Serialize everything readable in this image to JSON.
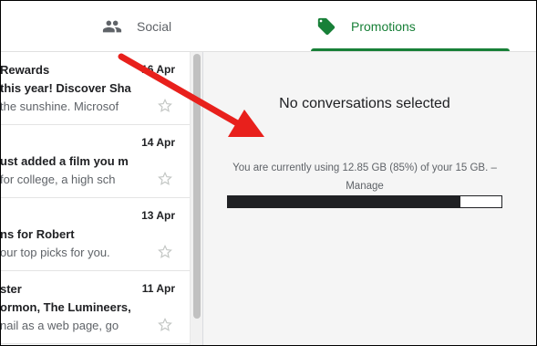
{
  "tabs": [
    {
      "label": "Social",
      "icon": "people-icon",
      "active": false
    },
    {
      "label": "Promotions",
      "icon": "tag-icon",
      "active": true
    }
  ],
  "colors": {
    "active_tab": "#188038",
    "arrow": "#e8201c",
    "bar_fill": "#202124"
  },
  "emails": [
    {
      "sender": "Rewards",
      "date": "16 Apr",
      "subject": "this year! Discover Sha",
      "snippet": "the sunshine. Microsof"
    },
    {
      "sender": "",
      "date": "14 Apr",
      "subject": "ust added a film you m",
      "snippet": "for college, a high sch"
    },
    {
      "sender": "",
      "date": "13 Apr",
      "subject": "ns for Robert",
      "snippet": "our top picks for you."
    },
    {
      "sender": "ster",
      "date": "11 Apr",
      "subject": "ormon, The Lumineers,",
      "snippet": "nail as a web page, go"
    }
  ],
  "pane": {
    "empty_message": "No conversations selected",
    "storage_text": "You are currently using 12.85 GB (85%) of your 15 GB. –",
    "manage_label": "Manage",
    "storage_fraction": 0.85
  }
}
